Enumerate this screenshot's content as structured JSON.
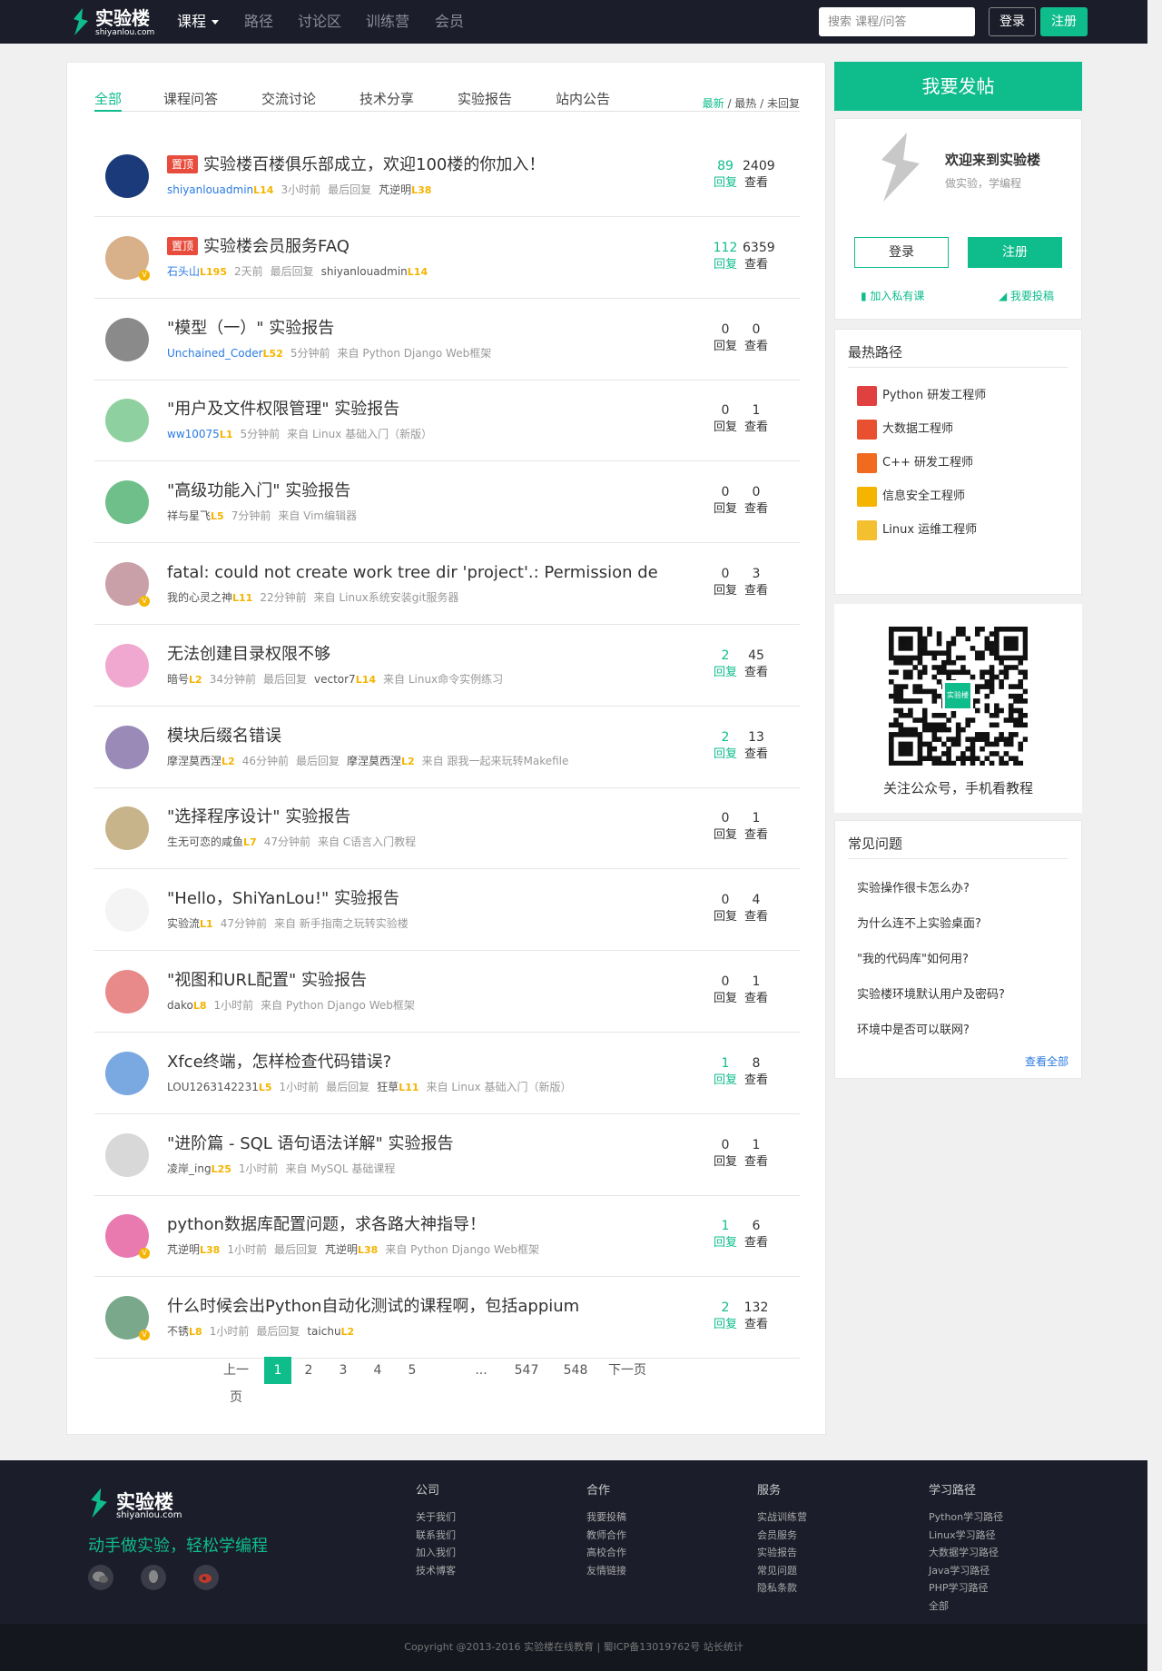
{
  "nav": {
    "logo_title": "实验楼",
    "logo_sub": "shiyanlou.com",
    "items": [
      "课程",
      "路径",
      "讨论区",
      "训练营",
      "会员"
    ],
    "search_placeholder": "搜索 课程/问答",
    "login": "登录",
    "register": "注册"
  },
  "tabs": [
    "全部",
    "课程问答",
    "交流讨论",
    "技术分享",
    "实验报告",
    "站内公告"
  ],
  "sorts": {
    "newest": "最新",
    "hottest": "最热",
    "unreplied": "未回复",
    "sep": " / "
  },
  "labels": {
    "reply": "回复",
    "view": "查看",
    "last_reply": "最后回复",
    "from": "来自",
    "pinned": "置顶"
  },
  "colors": {
    "accent": "#0fbc8c",
    "nav_bg": "#1b1d2a",
    "level": "#f4b400",
    "pin": "#e74c3c"
  },
  "posts": [
    {
      "pinned": true,
      "title": "实验楼百楼俱乐部成立，欢迎100楼的你加入！",
      "user": "shiyanlouadmin",
      "level": "L14",
      "time": "3小时前",
      "extra": "最后回复",
      "reply_user": "芃逆明",
      "reply_level": "L38",
      "source": "",
      "replies": "89",
      "views": "2409",
      "active": true,
      "avatar": "#1a3a7a",
      "vip": false,
      "blue": true
    },
    {
      "pinned": true,
      "title": "实验楼会员服务FAQ",
      "user": "石头山",
      "level": "L195",
      "time": "2天前",
      "extra": "最后回复",
      "reply_user": "shiyanlouadmin",
      "reply_level": "L14",
      "source": "",
      "replies": "112",
      "views": "6359",
      "active": true,
      "avatar": "#d8b08a",
      "vip": true,
      "blue": true
    },
    {
      "pinned": false,
      "title": "\"模型（一）\" 实验报告",
      "user": "Unchained_Coder",
      "level": "L52",
      "time": "5分钟前",
      "extra": "",
      "reply_user": "",
      "reply_level": "",
      "source": "来自 Python Django Web框架",
      "replies": "0",
      "views": "0",
      "active": false,
      "avatar": "#8a8a8a",
      "vip": false,
      "blue": true
    },
    {
      "pinned": false,
      "title": "\"用户及文件权限管理\" 实验报告",
      "user": "ww10075",
      "level": "L1",
      "time": "5分钟前",
      "extra": "",
      "reply_user": "",
      "reply_level": "",
      "source": "来自 Linux 基础入门（新版）",
      "replies": "0",
      "views": "1",
      "active": false,
      "avatar": "#8fd0a0",
      "vip": false,
      "blue": true
    },
    {
      "pinned": false,
      "title": "\"高级功能入门\" 实验报告",
      "user": "祥与星飞",
      "level": "L5",
      "time": "7分钟前",
      "extra": "",
      "reply_user": "",
      "reply_level": "",
      "source": "来自 Vim编辑器",
      "replies": "0",
      "views": "0",
      "active": false,
      "avatar": "#6fbf8a",
      "vip": false,
      "blue": false
    },
    {
      "pinned": false,
      "title": "fatal: could not create work tree dir 'project'.: Permission de...",
      "user": "我的心灵之神",
      "level": "L11",
      "time": "22分钟前",
      "extra": "",
      "reply_user": "",
      "reply_level": "",
      "source": "来自 Linux系统安装git服务器",
      "replies": "0",
      "views": "3",
      "active": false,
      "avatar": "#c9a0a8",
      "vip": true,
      "blue": false
    },
    {
      "pinned": false,
      "title": "无法创建目录权限不够",
      "user": "暗号",
      "level": "L2",
      "time": "34分钟前",
      "extra": "最后回复",
      "reply_user": "vector7",
      "reply_level": "L14",
      "source": "来自 Linux命令实例练习",
      "replies": "2",
      "views": "45",
      "active": true,
      "avatar": "#f0a8d0",
      "vip": false,
      "blue": false
    },
    {
      "pinned": false,
      "title": "模块后缀名错误",
      "user": "摩涅莫西涅",
      "level": "L2",
      "time": "46分钟前",
      "extra": "最后回复",
      "reply_user": "摩涅莫西涅",
      "reply_level": "L2",
      "source": "来自 跟我一起来玩转Makefile",
      "replies": "2",
      "views": "13",
      "active": true,
      "avatar": "#9a8ab8",
      "vip": false,
      "blue": false
    },
    {
      "pinned": false,
      "title": "\"选择程序设计\" 实验报告",
      "user": "生无可恋的咸鱼",
      "level": "L7",
      "time": "47分钟前",
      "extra": "",
      "reply_user": "",
      "reply_level": "",
      "source": "来自 C语言入门教程",
      "replies": "0",
      "views": "1",
      "active": false,
      "avatar": "#c8b48a",
      "vip": false,
      "blue": false
    },
    {
      "pinned": false,
      "title": "\"Hello，ShiYanLou!\" 实验报告",
      "user": "实验流",
      "level": "L1",
      "time": "47分钟前",
      "extra": "",
      "reply_user": "",
      "reply_level": "",
      "source": "来自 新手指南之玩转实验楼",
      "replies": "0",
      "views": "4",
      "active": false,
      "avatar": "#f4f4f4",
      "vip": false,
      "blue": false
    },
    {
      "pinned": false,
      "title": "\"视图和URL配置\" 实验报告",
      "user": "dako",
      "level": "L8",
      "time": "1小时前",
      "extra": "",
      "reply_user": "",
      "reply_level": "",
      "source": "来自 Python Django Web框架",
      "replies": "0",
      "views": "1",
      "active": false,
      "avatar": "#e88a8a",
      "vip": false,
      "blue": false
    },
    {
      "pinned": false,
      "title": "Xfce终端，怎样检查代码错误?",
      "user": "LOU1263142231",
      "level": "L5",
      "time": "1小时前",
      "extra": "最后回复",
      "reply_user": "狂草",
      "reply_level": "L11",
      "source": "来自 Linux 基础入门（新版）",
      "replies": "1",
      "views": "8",
      "active": true,
      "avatar": "#7aa8e0",
      "vip": false,
      "blue": false
    },
    {
      "pinned": false,
      "title": "\"进阶篇 - SQL 语句语法详解\" 实验报告",
      "user": "凌岸_ing",
      "level": "L25",
      "time": "1小时前",
      "extra": "",
      "reply_user": "",
      "reply_level": "",
      "source": "来自 MySQL 基础课程",
      "replies": "0",
      "views": "1",
      "active": false,
      "avatar": "#d8d8d8",
      "vip": false,
      "blue": false
    },
    {
      "pinned": false,
      "title": "python数据库配置问题，求各路大神指导！",
      "user": "芃逆明",
      "level": "L38",
      "time": "1小时前",
      "extra": "最后回复",
      "reply_user": "芃逆明",
      "reply_level": "L38",
      "source": "来自 Python Django Web框架",
      "replies": "1",
      "views": "6",
      "active": true,
      "avatar": "#e87ab0",
      "vip": true,
      "blue": false
    },
    {
      "pinned": false,
      "title": "什么时候会出Python自动化测试的课程啊，包括appium",
      "user": "不锈",
      "level": "L8",
      "time": "1小时前",
      "extra": "最后回复",
      "reply_user": "taichu",
      "reply_level": "L2",
      "source": "",
      "replies": "2",
      "views": "132",
      "active": true,
      "avatar": "#7aa88a",
      "vip": true,
      "blue": false
    }
  ],
  "pager": {
    "prev": "上一页",
    "pages": [
      "1",
      "2",
      "3",
      "4",
      "5",
      "...",
      "547",
      "548"
    ],
    "next": "下一页",
    "current": "1"
  },
  "sidebar": {
    "post_button": "我要发帖",
    "welcome_title": "欢迎来到实验楼",
    "welcome_sub": "做实验，学编程",
    "login": "登录",
    "register": "注册",
    "join_course": "加入私有课",
    "contribute": "我要投稿",
    "paths_title": "最热路径",
    "paths": [
      {
        "name": "Python 研发工程师",
        "color": "#e04040",
        "icon": "python-icon"
      },
      {
        "name": "大数据工程师",
        "color": "#e85030",
        "icon": "hadoop-icon"
      },
      {
        "name": "C++ 研发工程师",
        "color": "#f06a20",
        "icon": "cpp-icon"
      },
      {
        "name": "信息安全工程师",
        "color": "#f4b400",
        "icon": "lock-icon"
      },
      {
        "name": "Linux 运维工程师",
        "color": "#f4c030",
        "icon": "linux-icon"
      }
    ],
    "qr_caption": "关注公众号，手机看教程",
    "qr_logo": "实验楼",
    "faq_title": "常见问题",
    "faqs": [
      "实验操作很卡怎么办?",
      "为什么连不上实验桌面?",
      "\"我的代码库\"如何用?",
      "实验楼环境默认用户及密码?",
      "环境中是否可以联网?"
    ],
    "faq_more": "查看全部"
  },
  "footer": {
    "logo_title": "实验楼",
    "logo_sub": "shiyanlou.com",
    "slogan": "动手做实验，轻松学编程",
    "cols": [
      {
        "title": "公司",
        "items": [
          "关于我们",
          "联系我们",
          "加入我们",
          "技术博客"
        ]
      },
      {
        "title": "合作",
        "items": [
          "我要投稿",
          "教师合作",
          "高校合作",
          "友情链接"
        ]
      },
      {
        "title": "服务",
        "items": [
          "实战训练营",
          "会员服务",
          "实验报告",
          "常见问题",
          "隐私条款"
        ]
      },
      {
        "title": "学习路径",
        "items": [
          "Python学习路径",
          "Linux学习路径",
          "大数据学习路径",
          "Java学习路径",
          "PHP学习路径",
          "全部"
        ]
      }
    ],
    "copyright": "Copyright @2013-2016 实验楼在线教育 | 蜀ICP备13019762号 站长统计"
  }
}
